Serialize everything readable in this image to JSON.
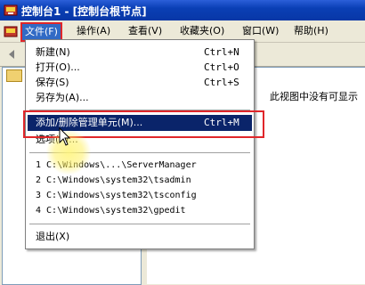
{
  "window": {
    "title": "控制台1 - [控制台根节点]"
  },
  "menubar": {
    "items": [
      {
        "label": "文件(F)"
      },
      {
        "label": "操作(A)"
      },
      {
        "label": "查看(V)"
      },
      {
        "label": "收藏夹(O)"
      },
      {
        "label": "窗口(W)"
      },
      {
        "label": "帮助(H)"
      }
    ]
  },
  "main": {
    "empty_message": "此视图中没有可显示"
  },
  "file_menu": {
    "items": [
      {
        "label": "新建(N)",
        "shortcut": "Ctrl+N"
      },
      {
        "label": "打开(O)...",
        "shortcut": "Ctrl+O"
      },
      {
        "label": "保存(S)",
        "shortcut": "Ctrl+S"
      },
      {
        "label": "另存为(A)..."
      },
      {
        "label": "添加/删除管理单元(M)...",
        "shortcut": "Ctrl+M"
      },
      {
        "label": "选项(P)..."
      }
    ],
    "recent": [
      "1 C:\\Windows\\...\\ServerManager",
      "2 C:\\Windows\\system32\\tsadmin",
      "3 C:\\Windows\\system32\\tsconfig",
      "4 C:\\Windows\\system32\\gpedit"
    ],
    "exit_label": "退出(X)"
  },
  "colors": {
    "highlight": "#0a246a",
    "annotation": "#e0262a",
    "titlebar": "#0a3fb5"
  }
}
